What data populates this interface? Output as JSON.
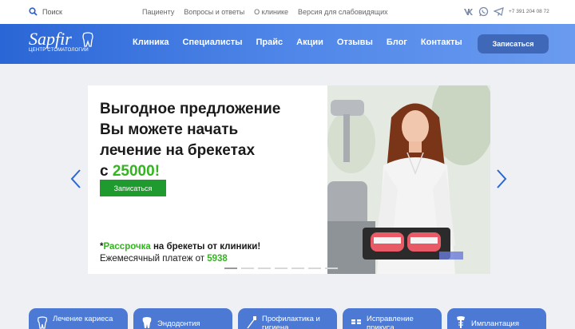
{
  "topbar": {
    "search_label": "Поиск",
    "links": [
      "Пациенту",
      "Вопросы и ответы",
      "О клинике",
      "Версия для слабовидящих"
    ],
    "phone": "+7 391 204 08 72"
  },
  "header": {
    "logo_word": "Sapfir",
    "logo_sub": "ЦЕНТР СТОМАТОЛОГИИ",
    "nav": [
      "Клиника",
      "Специалисты",
      "Прайс",
      "Акции",
      "Отзывы",
      "Блог",
      "Контакты"
    ],
    "signup_label": "Записаться"
  },
  "slide": {
    "line1": "Выгодное предложение",
    "line2": "Вы можете начать",
    "line3": "лечение на брекетах",
    "line4_prefix": "с ",
    "price": "25000!",
    "button_label": "Записаться",
    "promo_star": "*",
    "promo_green": "Рассрочка",
    "promo_rest": " на брекеты от клиники!",
    "monthly_text": "Ежемесячный платеж от ",
    "monthly_value": "5938",
    "dots_total": 7,
    "active_dot": 1
  },
  "services": [
    {
      "label": "Лечение кариеса",
      "icon": "tooth-icon"
    },
    {
      "label": "Эндодонтия",
      "icon": "tooth-root-icon"
    },
    {
      "label": "Профилактика и гигиена",
      "icon": "brush-icon"
    },
    {
      "label": "Исправление прикуса",
      "icon": "braces-icon"
    },
    {
      "label": "Имплантация",
      "icon": "implant-icon"
    }
  ],
  "colors": {
    "header_start": "#2b66d6",
    "header_end": "#6a9bf0",
    "accent_green": "#32b51f",
    "button_green": "#1f9a2e",
    "card_blue": "#4c79d4"
  }
}
